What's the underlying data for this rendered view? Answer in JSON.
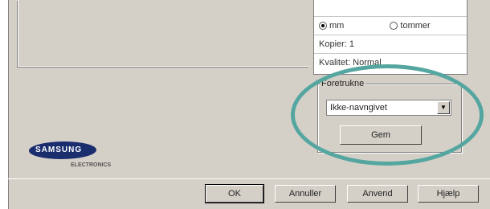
{
  "units": {
    "mm_label": "mm",
    "tommer_label": "tommer",
    "selected": "mm"
  },
  "copies": "Kopier: 1",
  "quality": "Kvalitet: Normal",
  "favorites": {
    "legend": "Foretrukne",
    "selected_value": "Ikke-navngivet",
    "save_label": "Gem"
  },
  "logo": {
    "brand": "SAMSUNG",
    "sub": "ELECTRONICS"
  },
  "buttons": {
    "ok": "OK",
    "cancel": "Annuller",
    "apply": "Anvend",
    "help": "Hjælp"
  },
  "colors": {
    "annotation_ellipse": "#55a6a0",
    "dialog_bg": "#d4d0c8"
  }
}
